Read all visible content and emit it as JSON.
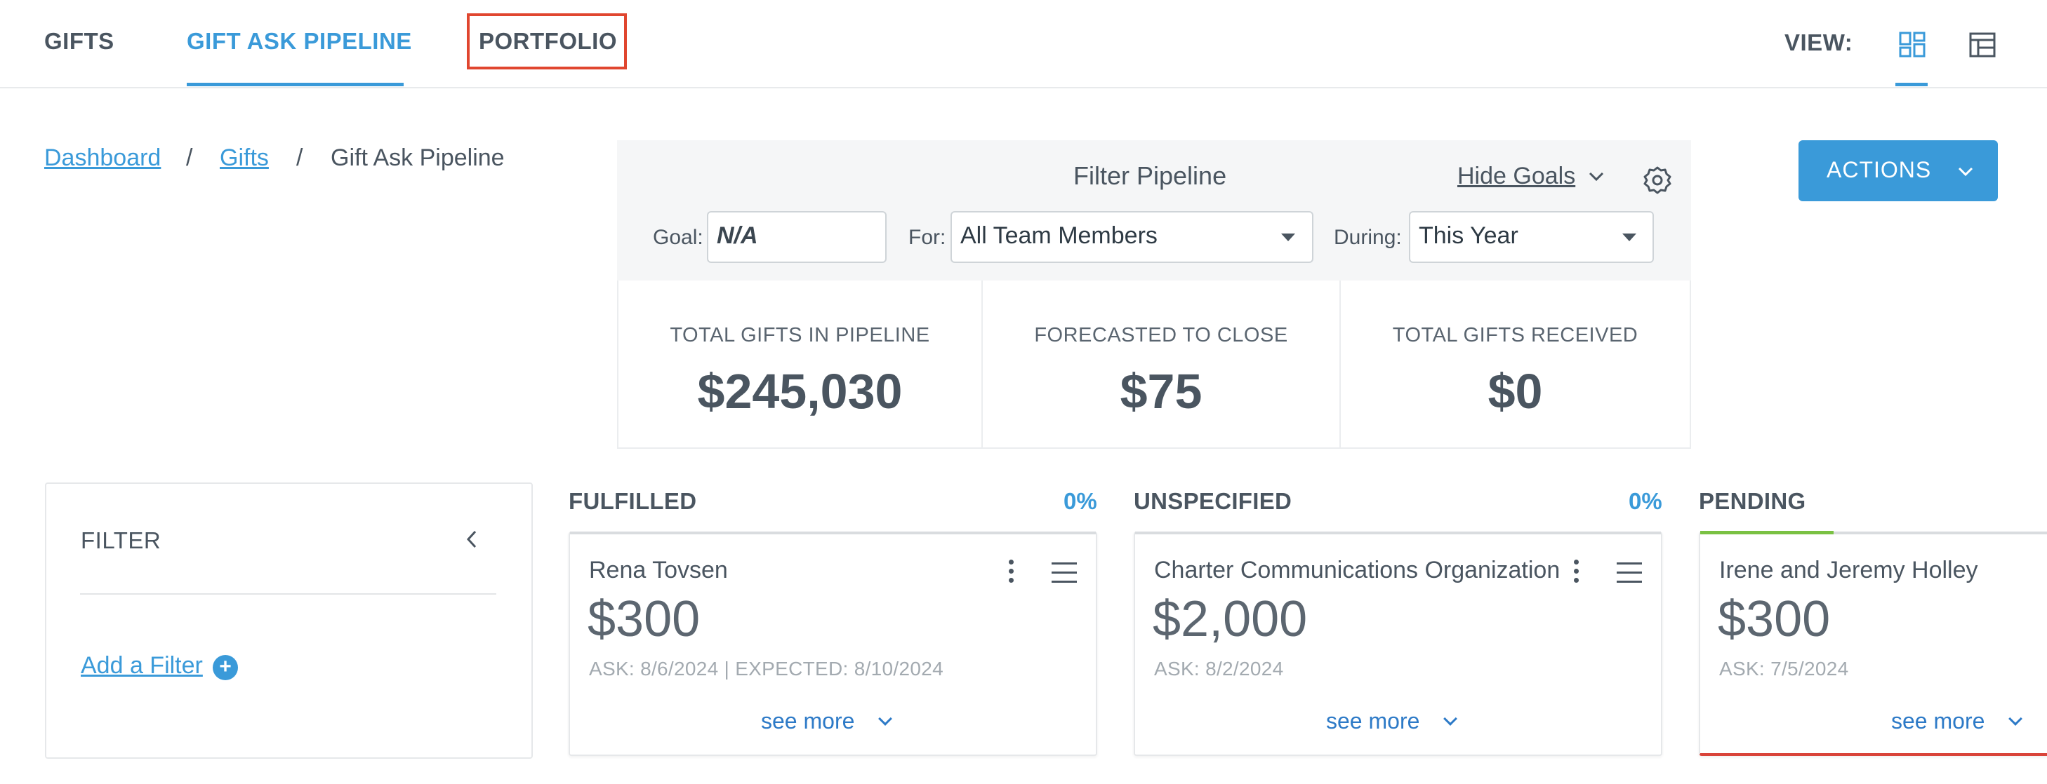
{
  "nav": {
    "tabs": [
      {
        "label": "GIFTS"
      },
      {
        "label": "GIFT ASK PIPELINE"
      },
      {
        "label": "PORTFOLIO"
      }
    ],
    "view_label": "VIEW:",
    "view_icons": [
      "board-view-icon",
      "table-view-icon"
    ]
  },
  "breadcrumb": {
    "items": [
      "Dashboard",
      "Gifts",
      "Gift Ask Pipeline"
    ],
    "separator": "/"
  },
  "pipeline_filter": {
    "title": "Filter Pipeline",
    "hide_goals_label": "Hide Goals",
    "goal_label": "Goal:",
    "goal_value": "N/A",
    "for_label": "For:",
    "for_value": "All Team Members",
    "during_label": "During:",
    "during_value": "This Year"
  },
  "totals": [
    {
      "label": "TOTAL GIFTS IN PIPELINE",
      "value": "$245,030"
    },
    {
      "label": "FORECASTED TO CLOSE",
      "value": "$75"
    },
    {
      "label": "TOTAL GIFTS RECEIVED",
      "value": "$0"
    }
  ],
  "actions": {
    "label": "ACTIONS"
  },
  "filter_sidebar": {
    "title": "FILTER",
    "add_filter_label": "Add a Filter",
    "plus": "+"
  },
  "columns": [
    {
      "title": "FULFILLED",
      "percent": "0%",
      "card": {
        "name": "Rena Tovsen",
        "amount": "$300",
        "meta": "ASK: 8/6/2024 | EXPECTED: 8/10/2024",
        "see_more": "see more"
      }
    },
    {
      "title": "UNSPECIFIED",
      "percent": "0%",
      "card": {
        "name": "Charter Communications Organization",
        "amount": "$2,000",
        "meta": "ASK: 8/2/2024",
        "see_more": "see more"
      }
    },
    {
      "title": "PENDING",
      "percent": "",
      "card": {
        "name": "Irene and Jeremy Holley",
        "amount": "$300",
        "meta": "ASK: 7/5/2024",
        "see_more": "see more"
      }
    }
  ],
  "colors": {
    "accent": "#3a9ad9",
    "highlight_box": "#e0462f",
    "pending_progress": "#7ac143",
    "pending_bottom": "#d9443a"
  }
}
